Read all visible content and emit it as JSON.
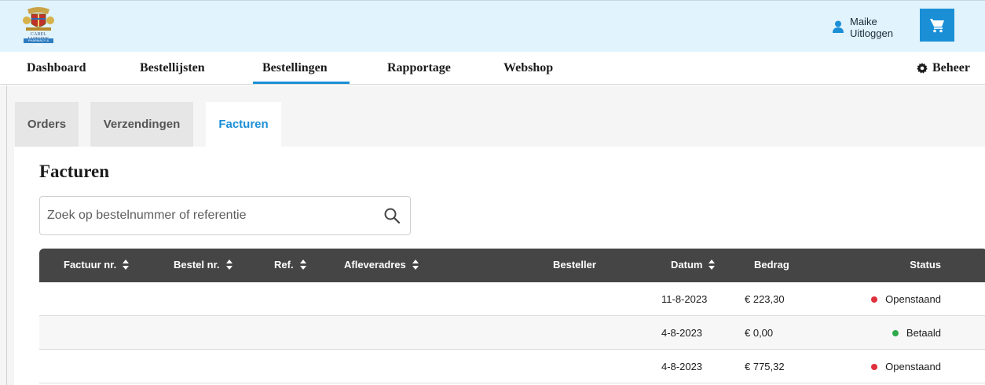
{
  "header": {
    "logo_name": "CAREL LURVINK",
    "logo_subtitle": "PHARMACY & FOOD",
    "user_name": "Maike",
    "logout_label": "Uitloggen",
    "cart_icon": "shopping-cart-icon",
    "accent_color": "#1b8fd6"
  },
  "nav": {
    "items": [
      {
        "label": "Dashboard"
      },
      {
        "label": "Bestellijsten"
      },
      {
        "label": "Bestellingen"
      },
      {
        "label": "Rapportage"
      },
      {
        "label": "Webshop"
      }
    ],
    "active": "Bestellingen",
    "settings_label": "Beheer"
  },
  "subtabs": {
    "items": [
      {
        "label": "Orders"
      },
      {
        "label": "Verzendingen"
      },
      {
        "label": "Facturen"
      }
    ],
    "active": "Facturen"
  },
  "page": {
    "title": "Facturen",
    "search_placeholder": "Zoek op bestelnummer of referentie",
    "search_value": ""
  },
  "table": {
    "columns": [
      {
        "label": "Factuur nr.",
        "sortable": true
      },
      {
        "label": "Bestel nr.",
        "sortable": true
      },
      {
        "label": "Ref.",
        "sortable": true
      },
      {
        "label": "Afleveradres",
        "sortable": true
      },
      {
        "label": "Besteller",
        "sortable": false
      },
      {
        "label": "Datum",
        "sortable": true
      },
      {
        "label": "Bedrag",
        "sortable": false
      },
      {
        "label": "Status",
        "sortable": false
      }
    ],
    "rows": [
      {
        "factuur": "",
        "bestel": "",
        "ref": "",
        "adres": "",
        "besteller": "",
        "datum": "11-8-2023",
        "bedrag": "€ 223,30",
        "status": "Openstaand",
        "status_color": "#e0303b"
      },
      {
        "factuur": "",
        "bestel": "",
        "ref": "",
        "adres": "",
        "besteller": "",
        "datum": "4-8-2023",
        "bedrag": "€ 0,00",
        "status": "Betaald",
        "status_color": "#2eaa4a"
      },
      {
        "factuur": "",
        "bestel": "",
        "ref": "",
        "adres": "",
        "besteller": "",
        "datum": "4-8-2023",
        "bedrag": "€ 775,32",
        "status": "Openstaand",
        "status_color": "#e0303b"
      }
    ]
  }
}
